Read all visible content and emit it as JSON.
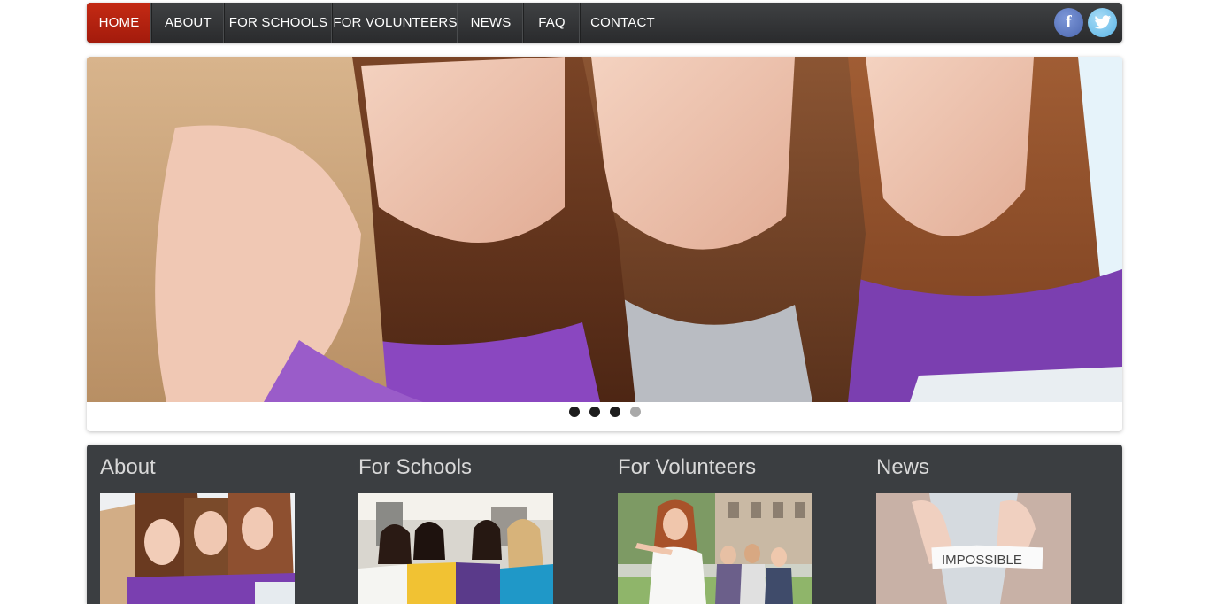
{
  "nav": {
    "items": [
      {
        "label": "HOME",
        "active": true
      },
      {
        "label": "ABOUT",
        "active": false
      },
      {
        "label": "FOR SCHOOLS",
        "active": false
      },
      {
        "label": "FOR VOLUNTEERS",
        "active": false
      },
      {
        "label": "NEWS",
        "active": false
      },
      {
        "label": "FAQ",
        "active": false
      },
      {
        "label": "CONTACT",
        "active": false
      }
    ],
    "social": [
      {
        "icon": "facebook-icon",
        "glyph": "f"
      },
      {
        "icon": "twitter-icon",
        "glyph": ""
      }
    ]
  },
  "slider": {
    "image": "students-looking-at-laptop-photo",
    "active_slide": 4,
    "dot_count": 4
  },
  "boxes": [
    {
      "title": "About",
      "image": "girls-studying-photo"
    },
    {
      "title": "For Schools",
      "image": "students-group-photo"
    },
    {
      "title": "For Volunteers",
      "image": "volunteer-pointing-photo"
    },
    {
      "title": "News",
      "image": "impossible-paper-photo",
      "image_text": "IMPOSSIBLE"
    }
  ],
  "colors": {
    "nav_bg": "#2f3133",
    "nav_active": "#b52312",
    "boxes_bg": "#3b3e41",
    "facebook": "#5a74bb",
    "twitter": "#74c4ee"
  }
}
